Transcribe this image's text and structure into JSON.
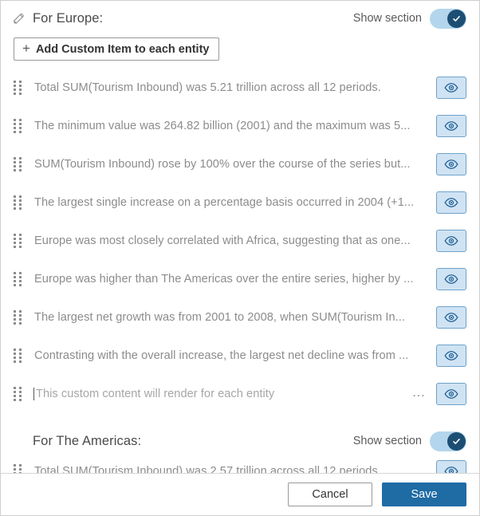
{
  "colors": {
    "accent": "#1f6ba4",
    "toggle_track": "#b3d6ed",
    "toggle_knob": "#1c4e73",
    "eye_button_fill": "#cfe3f3",
    "eye_button_border": "#6ea2ca",
    "text_muted": "#8c8c8c"
  },
  "sections": [
    {
      "title": "For Europe:",
      "edit_icon": "pencil-icon",
      "show_section_label": "Show section",
      "toggle_state": "on",
      "add_button_label": "Add Custom Item to each entity",
      "add_button_icon": "plus-icon",
      "items": [
        {
          "text": "Total SUM(Tourism Inbound) was 5.21 trillion across all 12 periods.",
          "visibility_icon": "eye-icon",
          "custom": false
        },
        {
          "text": "The minimum value was 264.82 billion (2001) and the maximum was 5...",
          "visibility_icon": "eye-icon",
          "custom": false
        },
        {
          "text": "SUM(Tourism Inbound) rose by 100% over the course of the series but...",
          "visibility_icon": "eye-icon",
          "custom": false
        },
        {
          "text": "The largest single increase on a percentage basis occurred in 2004 (+1...",
          "visibility_icon": "eye-icon",
          "custom": false
        },
        {
          "text": "Europe was most closely correlated with Africa, suggesting that as one...",
          "visibility_icon": "eye-icon",
          "custom": false
        },
        {
          "text": "Europe was higher than The Americas over the entire series, higher by ...",
          "visibility_icon": "eye-icon",
          "custom": false
        },
        {
          "text": "The largest net growth was from 2001 to 2008, when SUM(Tourism In...",
          "visibility_icon": "eye-icon",
          "custom": false
        },
        {
          "text": "Contrasting with the overall increase, the largest net decline was from ...",
          "visibility_icon": "eye-icon",
          "custom": false
        }
      ],
      "custom_item": {
        "placeholder": "This custom content will render for each entity",
        "value": "",
        "more_menu_label": "…",
        "visibility_icon": "eye-icon"
      }
    },
    {
      "title": "For The Americas:",
      "show_section_label": "Show section",
      "toggle_state": "on",
      "items": [
        {
          "text": "Total SUM(Tourism Inbound) was 2.57 trillion across all 12 periods.",
          "visibility_icon": "eye-icon",
          "custom": false
        }
      ]
    }
  ],
  "footer": {
    "cancel_label": "Cancel",
    "save_label": "Save"
  }
}
